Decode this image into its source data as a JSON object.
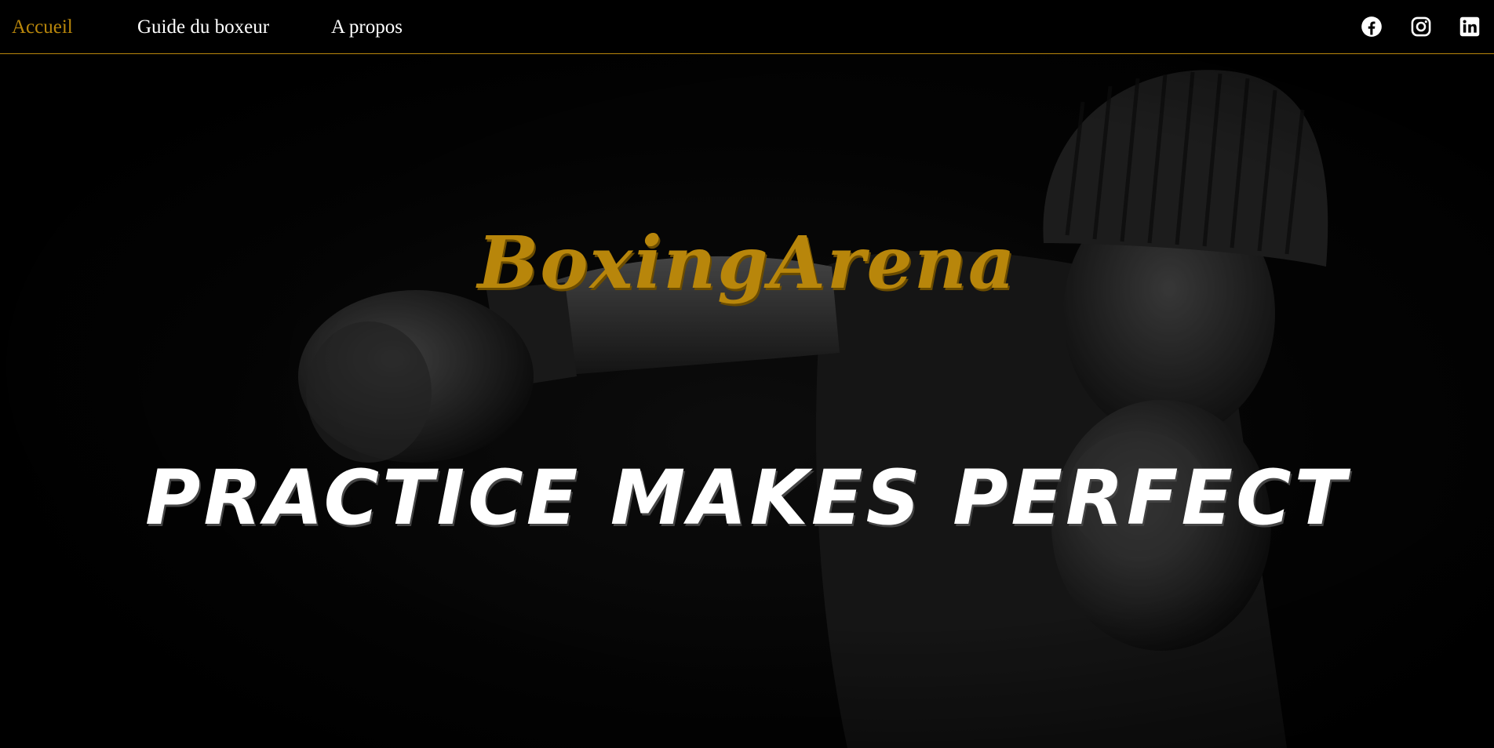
{
  "nav": {
    "links": [
      {
        "label": "Accueil",
        "active": true
      },
      {
        "label": "Guide du boxeur",
        "active": false
      },
      {
        "label": "A propos",
        "active": false
      }
    ],
    "social": [
      {
        "icon": "facebook-icon"
      },
      {
        "icon": "instagram-icon"
      },
      {
        "icon": "linkedin-icon"
      }
    ]
  },
  "hero": {
    "brand": "BoxingArena",
    "tagline": "Practice makes perfect"
  },
  "colors": {
    "accent": "#b8860b",
    "background": "#000000",
    "text": "#ffffff"
  }
}
